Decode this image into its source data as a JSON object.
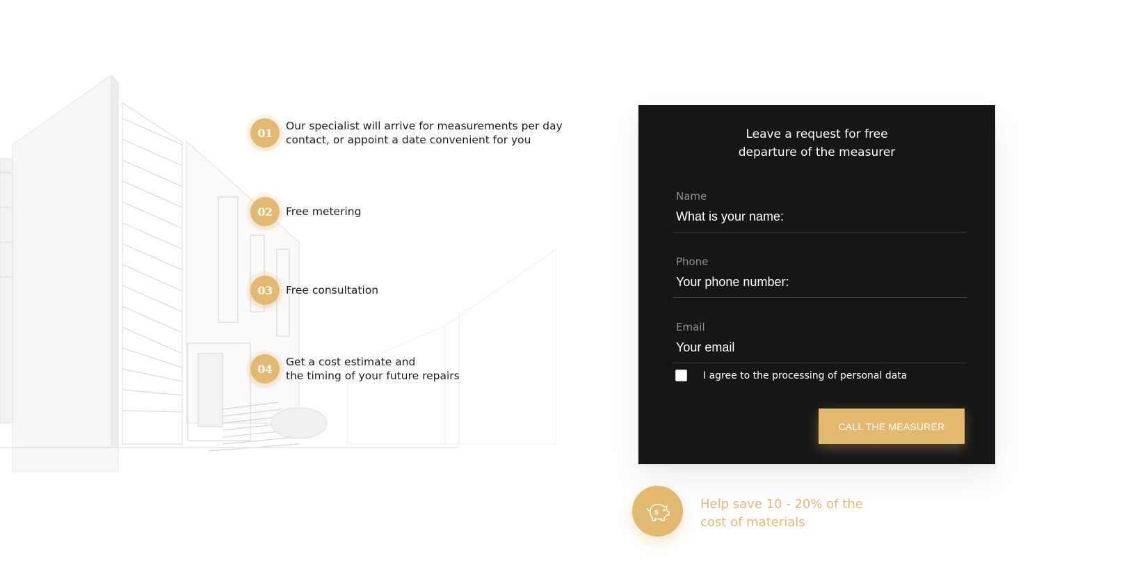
{
  "steps": [
    {
      "number": "01",
      "lines": [
        "Our specialist will arrive for measurements per day",
        "contact, or appoint a date convenient for you"
      ]
    },
    {
      "number": "02",
      "lines": [
        "Free metering"
      ]
    },
    {
      "number": "03",
      "lines": [
        "Free consultation"
      ]
    },
    {
      "number": "04",
      "lines": [
        "Get a cost estimate and",
        "the timing of your future repairs"
      ]
    }
  ],
  "form": {
    "title_lines": [
      "Leave a request for free",
      "departure of the measurer"
    ],
    "name": {
      "label": "Name",
      "placeholder": "What is your name:"
    },
    "phone": {
      "label": "Phone",
      "placeholder": "Your phone number:"
    },
    "email": {
      "label": "Email",
      "placeholder": "Your email"
    },
    "agree_label": "I agree to the processing of personal data",
    "submit_label": "CALL THE MEASURER"
  },
  "promo": {
    "icon": "piggy-bank-icon",
    "lines": [
      "Help save 10 - 20% of the",
      "cost of materials"
    ]
  },
  "colors": {
    "accent": "#e2b96f",
    "card_bg": "#161616",
    "text_dark": "#1d1d1d"
  }
}
